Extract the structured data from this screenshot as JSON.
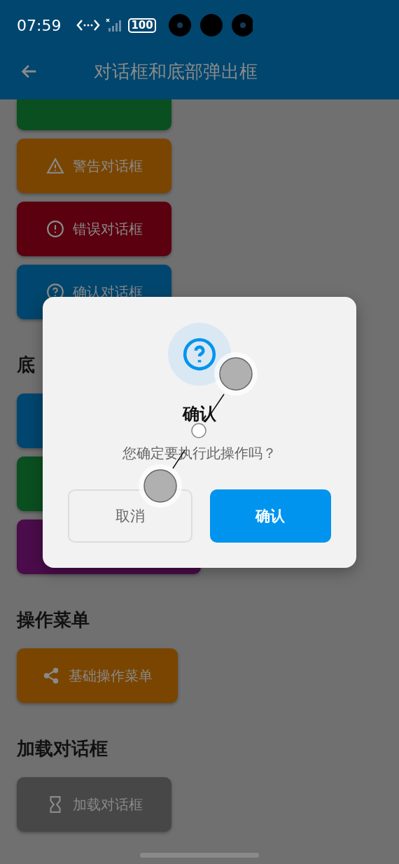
{
  "status_bar": {
    "time": "07:59",
    "battery": "100"
  },
  "app_bar": {
    "title": "对话框和底部弹出框"
  },
  "sections": [
    {
      "buttons": [
        {
          "kind": "blank",
          "color": "#0a4f20",
          "wide": false
        },
        {
          "label": "警告对话框",
          "kind": "warning",
          "color": "#7a4500"
        },
        {
          "label": "错误对话框",
          "kind": "error",
          "color": "#5a000f"
        },
        {
          "label": "确认对话框",
          "kind": "help",
          "color": "#00466e"
        }
      ]
    },
    {
      "heading": "底",
      "buttons": [
        {
          "kind": "blank",
          "color": "#00466e",
          "wide": false
        },
        {
          "kind": "blank",
          "color": "#0a4f20",
          "wide": false
        },
        {
          "kind": "blank",
          "color": "#4a0c4a",
          "wide": true
        }
      ]
    },
    {
      "heading": "操作菜单",
      "buttons": [
        {
          "label": "基础操作菜单",
          "kind": "share",
          "color": "#7a4500"
        }
      ]
    },
    {
      "heading": "加载对话框",
      "buttons": [
        {
          "label": "加载对话框",
          "kind": "hourglass",
          "color": "#474747"
        }
      ]
    }
  ],
  "dialog": {
    "title": "确认",
    "message": "您确定要执行此操作吗？",
    "buttons": [
      {
        "label": "取消",
        "kind": "outline"
      },
      {
        "label": "确认",
        "kind": "primary"
      }
    ]
  }
}
